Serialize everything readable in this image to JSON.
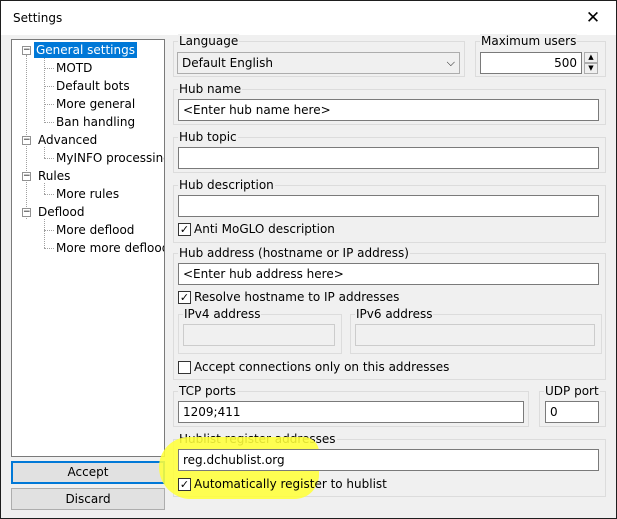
{
  "window": {
    "title": "Settings"
  },
  "colors": {
    "selection": "#0078d7",
    "highlight": "#ffff3a"
  },
  "tree": [
    {
      "label": "General settings",
      "selected": true
    },
    {
      "label": "MOTD"
    },
    {
      "label": "Default bots"
    },
    {
      "label": "More general"
    },
    {
      "label": "Ban handling"
    },
    {
      "label": "Advanced"
    },
    {
      "label": "MyINFO processing"
    },
    {
      "label": "Rules"
    },
    {
      "label": "More rules"
    },
    {
      "label": "Deflood"
    },
    {
      "label": "More deflood"
    },
    {
      "label": "More more deflood"
    }
  ],
  "buttons": {
    "accept": "Accept",
    "discard": "Discard"
  },
  "language": {
    "label": "Language",
    "value": "Default English"
  },
  "max_users": {
    "label": "Maximum users",
    "value": "500"
  },
  "hub_name": {
    "label": "Hub name",
    "value": "<Enter hub name here>"
  },
  "hub_topic": {
    "label": "Hub topic",
    "value": ""
  },
  "hub_description": {
    "label": "Hub description",
    "value": "",
    "anti_moglo_label": "Anti MoGLO description",
    "anti_moglo_checked": true
  },
  "hub_address": {
    "label": "Hub address (hostname or IP address)",
    "value": "<Enter hub address here>",
    "resolve_label": "Resolve hostname to IP addresses",
    "resolve_checked": true,
    "ipv4_label": "IPv4 address",
    "ipv4_value": "",
    "ipv6_label": "IPv6 address",
    "ipv6_value": ""
  },
  "accept_only": {
    "label": "Accept connections only on this addresses",
    "checked": false
  },
  "tcp_ports": {
    "label": "TCP ports",
    "value": "1209;411"
  },
  "udp_port": {
    "label": "UDP port",
    "value": "0"
  },
  "hublist": {
    "label": "Hublist register addresses",
    "value": "reg.dchublist.org",
    "auto_label": "Automatically register to hublist",
    "auto_checked": true
  },
  "icons": {
    "close": "close-icon",
    "dropdown": "chevron-down-icon",
    "spin_up": "spin-up-icon",
    "spin_down": "spin-down-icon",
    "check": "checkmark-icon",
    "expander": "tree-expander-icon"
  }
}
